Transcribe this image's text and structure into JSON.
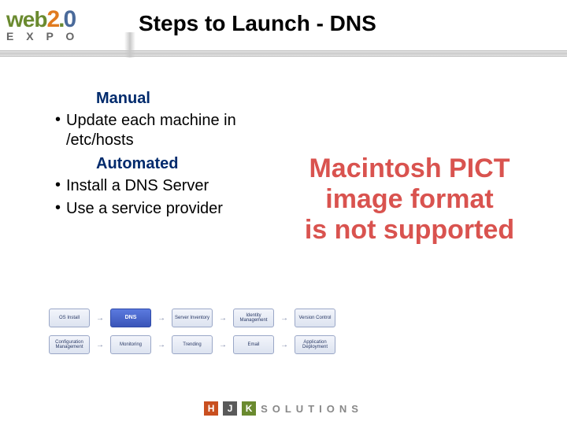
{
  "logo": {
    "web": "web",
    "two": "2",
    "dot": ".",
    "zero": "0",
    "expo": "E X P O"
  },
  "title": "Steps to Launch - DNS",
  "sections": {
    "manual": {
      "heading": "Manual",
      "items": [
        "Update each machine in /etc/hosts"
      ]
    },
    "automated": {
      "heading": "Automated",
      "items": [
        "Install a DNS Server",
        "Use a service provider"
      ]
    }
  },
  "error": {
    "l1": "Macintosh PICT",
    "l2": "image format",
    "l3": "is not supported"
  },
  "flow": {
    "row1": [
      "OS Install",
      "DNS",
      "Server Inventory",
      "Identity Management",
      "Version Control"
    ],
    "active_index": 1,
    "row2": [
      "Configuration Management",
      "Monitoring",
      "Trending",
      "Email",
      "Application Deployment"
    ]
  },
  "footer": {
    "h": "H",
    "j": "J",
    "k": "K",
    "text": "SOLUTIONS"
  }
}
